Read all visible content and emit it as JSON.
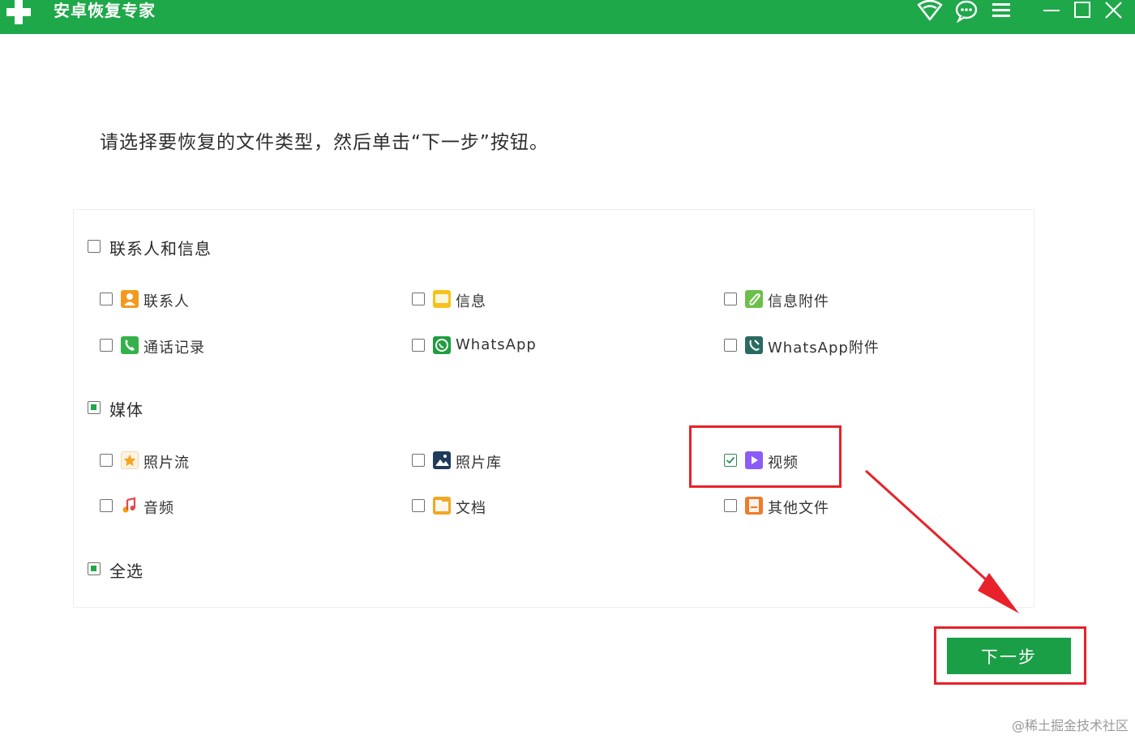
{
  "window": {
    "title": "安卓恢复专家",
    "accent_color": "#1fa84a",
    "icons": [
      "wifi-icon",
      "chat-icon",
      "menu-icon",
      "minimize-icon",
      "maximize-icon",
      "close-icon"
    ]
  },
  "instruction": "请选择要恢复的文件类型，然后单击“下一步”按钮。",
  "groups": [
    {
      "label": "联系人和信息",
      "state": "unchecked",
      "items": [
        {
          "label": "联系人",
          "icon": "contacts-icon",
          "checked": false
        },
        {
          "label": "信息",
          "icon": "messages-icon",
          "checked": false
        },
        {
          "label": "信息附件",
          "icon": "message-attachment-icon",
          "checked": false
        },
        {
          "label": "通话记录",
          "icon": "call-log-icon",
          "checked": false
        },
        {
          "label": "WhatsApp",
          "icon": "whatsapp-icon",
          "checked": false
        },
        {
          "label": "WhatsApp附件",
          "icon": "whatsapp-attachment-icon",
          "checked": false
        }
      ]
    },
    {
      "label": "媒体",
      "state": "partial",
      "items": [
        {
          "label": "照片流",
          "icon": "photo-stream-icon",
          "checked": false
        },
        {
          "label": "照片库",
          "icon": "photo-library-icon",
          "checked": false
        },
        {
          "label": "视频",
          "icon": "video-icon",
          "checked": true
        },
        {
          "label": "音频",
          "icon": "audio-icon",
          "checked": false
        },
        {
          "label": "文档",
          "icon": "document-icon",
          "checked": false
        },
        {
          "label": "其他文件",
          "icon": "other-files-icon",
          "checked": false
        }
      ]
    }
  ],
  "select_all": {
    "label": "全选",
    "state": "partial"
  },
  "next_button": "下一步",
  "highlight_color": "#e8222a",
  "watermark": "@稀土掘金技术社区"
}
